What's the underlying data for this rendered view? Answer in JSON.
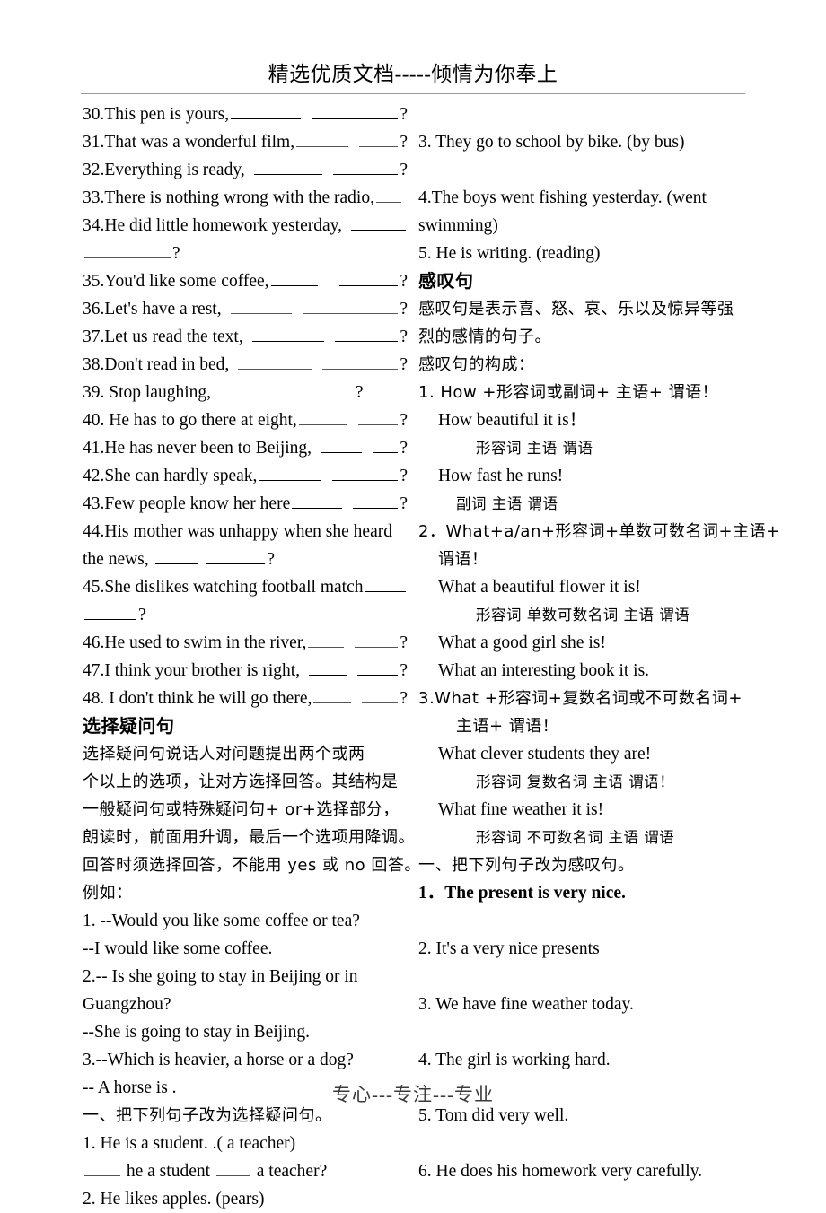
{
  "document": {
    "header_text": "精选优质文档-----倾情为你奉上",
    "footer_text": "专心---专注---专业"
  },
  "left_column": {
    "tag_questions": [
      {
        "num": "30.",
        "text": "This pen is yours,",
        "blanks": [
          9,
          10
        ],
        "end": "?"
      },
      {
        "num": "31.",
        "text": "That was a wonderful film,",
        "blanks": [
          7,
          6
        ],
        "end": "?"
      },
      {
        "num": "32.",
        "text": "Everything is ready,",
        "blanks": [
          9,
          8
        ],
        "end": "?"
      },
      {
        "num": "33.",
        "text": "There is nothing wrong with the radio,",
        "blanks": [
          3
        ],
        "end": ""
      },
      {
        "num": "34.",
        "text": "He did little homework yesterday,",
        "blanks": [
          8
        ],
        "end": "",
        "cont_blanks": [
          11
        ],
        "cont_end": "?"
      },
      {
        "num": "35.",
        "text": "You'd like some coffee,",
        "blanks": [
          6,
          6
        ],
        "end": "?"
      },
      {
        "num": "36.",
        "text": "Let's have a rest,",
        "blanks": [
          8,
          12
        ],
        "end": "?"
      },
      {
        "num": "37.",
        "text": "Let us read the text,",
        "blanks": [
          9,
          8
        ],
        "end": "?"
      },
      {
        "num": "38.",
        "text": "Don't read in bed,",
        "blanks": [
          9,
          10
        ],
        "end": "?"
      },
      {
        "num": "39. ",
        "text": "Stop laughing,",
        "blanks": [
          7,
          10
        ],
        "end": "?"
      },
      {
        "num": "40. ",
        "text": "He has to go there at eight,",
        "blanks": [
          6,
          5
        ],
        "end": "?"
      },
      {
        "num": "41.",
        "text": "He has never been to Beijing,",
        "blanks": [
          5,
          4
        ],
        "end": "?"
      },
      {
        "num": "42.",
        "text": "She can hardly speak,",
        "blanks": [
          8,
          9
        ],
        "end": "?"
      },
      {
        "num": "43.",
        "text": "Few people know her here",
        "blanks": [
          6,
          5
        ],
        "end": "?"
      },
      {
        "num": "44.",
        "text": "His mother was unhappy when she heard",
        "blanks": [],
        "end": "",
        "cont_text": "the news,",
        "cont_blanks": [
          5,
          7
        ],
        "cont_end": "?"
      },
      {
        "num": "45.",
        "text": "She dislikes watching football match",
        "blanks": [
          4
        ],
        "end": "",
        "cont_blanks": [
          6
        ],
        "cont_end": "?"
      },
      {
        "num": "46.",
        "text": "He used to swim in the river,",
        "blanks": [
          4,
          5
        ],
        "end": "?"
      },
      {
        "num": "47.",
        "text": "I think your brother is right,",
        "blanks": [
          4,
          6
        ],
        "end": "?"
      },
      {
        "num": "48. ",
        "text": "I don't think he will go there,",
        "blanks": [
          4,
          5
        ],
        "end": "?"
      }
    ],
    "section_title": "选择疑问句",
    "section_body": [
      "   选择疑问句说话人对问题提出两个或两",
      "个以上的选项，让对方选择回答。其结构是",
      "一般疑问句或特殊疑问句+ or+选择部分，",
      "朗读时，前面用升调，最后一个选项用降调。",
      "回答时须选择回答，不能用 yes 或 no 回答。",
      "例如："
    ],
    "examples": [
      "1. --Would you like some coffee or tea?",
      "    --I would like some coffee.",
      "2.-- Is she going to stay in Beijing or in",
      "        Guangzhou?",
      "    --She is going to stay in Beijing.",
      "3.--Which is heavier, a horse or a dog?",
      "  -- A horse is ."
    ],
    "exercise_title": "一、把下列句子改为选择疑问句。",
    "exercise_items": [
      {
        "text": "1. He is a student. .( a teacher)"
      },
      {
        "text_parts": [
          "",
          " he a student ",
          " a teacher?"
        ],
        "blanks": [
          5,
          5
        ],
        "indent": true
      },
      {
        "text": "2. He likes apples. (pears)"
      }
    ]
  },
  "right_column": {
    "rewrite_items": [
      "3. They go to school by bike. (by bus)",
      "4.The boys went fishing yesterday. (went",
      "swimming)",
      "5. He is writing. (reading)"
    ],
    "section_title": "感叹句",
    "section_body": [
      "感叹句是表示喜、怒、哀、乐以及惊异等强",
      "烈的感情的句子。",
      "感叹句的构成："
    ],
    "patterns": [
      {
        "rule": "1. How +形容词或副词+ 主语+ 谓语！",
        "examples": [
          {
            "words": "How    beautiful    it     is！",
            "labels": "形容词   主语   谓语"
          },
          {
            "words": " How    fast    he     runs!",
            "labels": "副词   主语   谓语"
          }
        ]
      },
      {
        "rule": "2．What+a/an+形容词+单数可数名词+主语+",
        "rule2": "谓语！",
        "examples": [
          {
            "words": "What a beautiful    flower              it        is!",
            "labels": "形容词    单数可数名词     主语   谓语"
          }
        ],
        "extra": [
          "What a good girl she is!",
          "What an interesting book it is."
        ]
      },
      {
        "rule": "3.What +形容词+复数名词或不可数名词+",
        "rule2": "主语+ 谓语！",
        "examples": [
          {
            "words": "What    clever    students    they    are!",
            "labels": "形容词  复数名词     主语    谓语！"
          },
          {
            "words": "What    fine      weather         it     is!",
            "labels": "形容词   不可数名词   主语   谓语"
          }
        ]
      }
    ],
    "exercise_title": "一、把下列句子改为感叹句。",
    "exercise_items": [
      "1．The present is very nice.",
      "2. It's a very nice presents",
      "3. We have fine weather today.",
      "4. The girl is working hard.",
      "5. Tom did very well.",
      "6. He does his homework very carefully."
    ]
  }
}
